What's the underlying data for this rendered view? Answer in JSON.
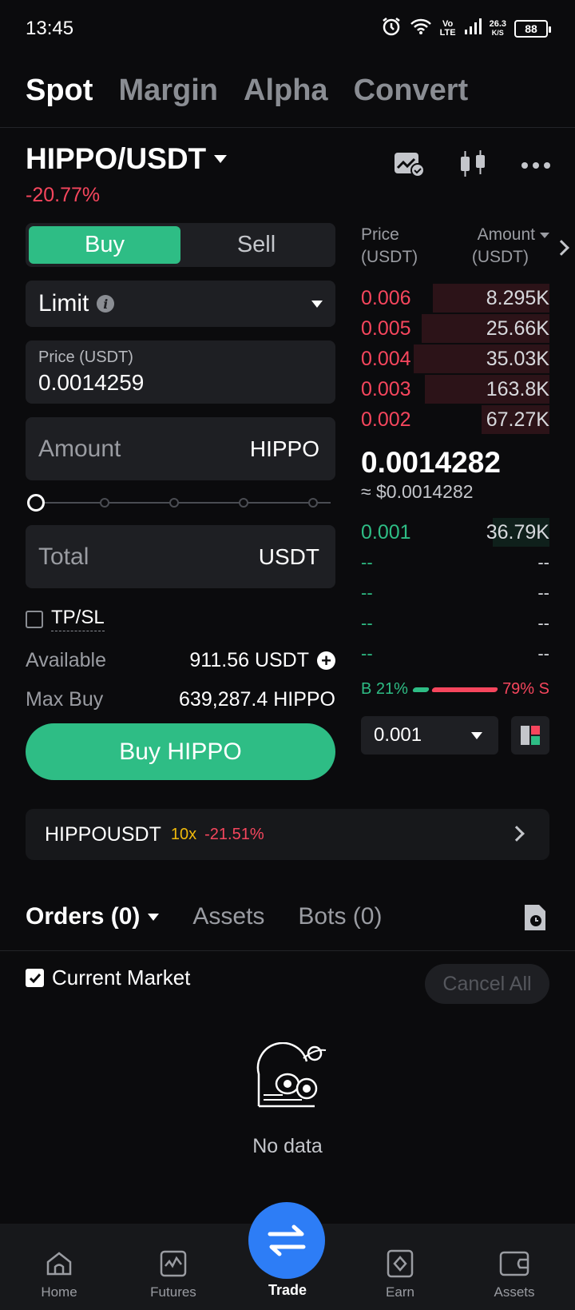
{
  "status_bar": {
    "time": "13:45",
    "net_label": "Vo",
    "net_type": "LTE",
    "speed_value": "26.3",
    "speed_unit": "K/S",
    "battery": "88"
  },
  "top_tabs": [
    "Spot",
    "Margin",
    "Alpha",
    "Convert"
  ],
  "market": {
    "pair": "HIPPO/USDT",
    "change": "-20.77%"
  },
  "order_form": {
    "buy_label": "Buy",
    "sell_label": "Sell",
    "order_type": "Limit",
    "price_label": "Price (USDT)",
    "price_value": "0.0014259",
    "amount_placeholder": "Amount",
    "amount_unit": "HIPPO",
    "slider_percent": 0,
    "total_placeholder": "Total",
    "total_unit": "USDT",
    "tpsl_label": "TP/SL",
    "available_label": "Available",
    "available_value": "911.56 USDT",
    "max_buy_label": "Max Buy",
    "max_buy_value": "639,287.4 HIPPO",
    "submit_label": "Buy HIPPO"
  },
  "order_book": {
    "price_header": "Price",
    "price_unit": "(USDT)",
    "amount_header": "Amount",
    "amount_unit": "(USDT)",
    "asks": [
      {
        "price": "0.006",
        "amount": "8.295K",
        "depth": 0.62
      },
      {
        "price": "0.005",
        "amount": "25.66K",
        "depth": 0.68
      },
      {
        "price": "0.004",
        "amount": "35.03K",
        "depth": 0.72
      },
      {
        "price": "0.003",
        "amount": "163.8K",
        "depth": 0.66
      },
      {
        "price": "0.002",
        "amount": "67.27K",
        "depth": 0.36
      }
    ],
    "last_price": "0.0014282",
    "last_price_usd": "≈ $0.0014282",
    "bids": [
      {
        "price": "0.001",
        "amount": "36.79K",
        "depth": 0.3
      }
    ],
    "empty_bids": [
      {
        "price": "--",
        "amount": "--"
      },
      {
        "price": "--",
        "amount": "--"
      },
      {
        "price": "--",
        "amount": "--"
      },
      {
        "price": "--",
        "amount": "--"
      }
    ],
    "buy_ratio_label": "B 21%",
    "sell_ratio_label": "79% S",
    "buy_ratio": 0.21,
    "depth_value": "0.001"
  },
  "futures_banner": {
    "symbol": "HIPPOUSDT",
    "leverage": "10x",
    "change": "-21.51%"
  },
  "orders_section": {
    "tabs": [
      "Orders (0)",
      "Assets",
      "Bots (0)"
    ],
    "current_market_label": "Current Market",
    "cancel_all_label": "Cancel All",
    "empty_text": "No data"
  },
  "bottom_nav": [
    "Home",
    "Futures",
    "Trade",
    "Earn",
    "Assets"
  ],
  "colors": {
    "buy_green": "#2ebd85",
    "sell_red": "#f6465d",
    "accent_blue": "#2d7df6",
    "leverage_yellow": "#f0b90b"
  }
}
